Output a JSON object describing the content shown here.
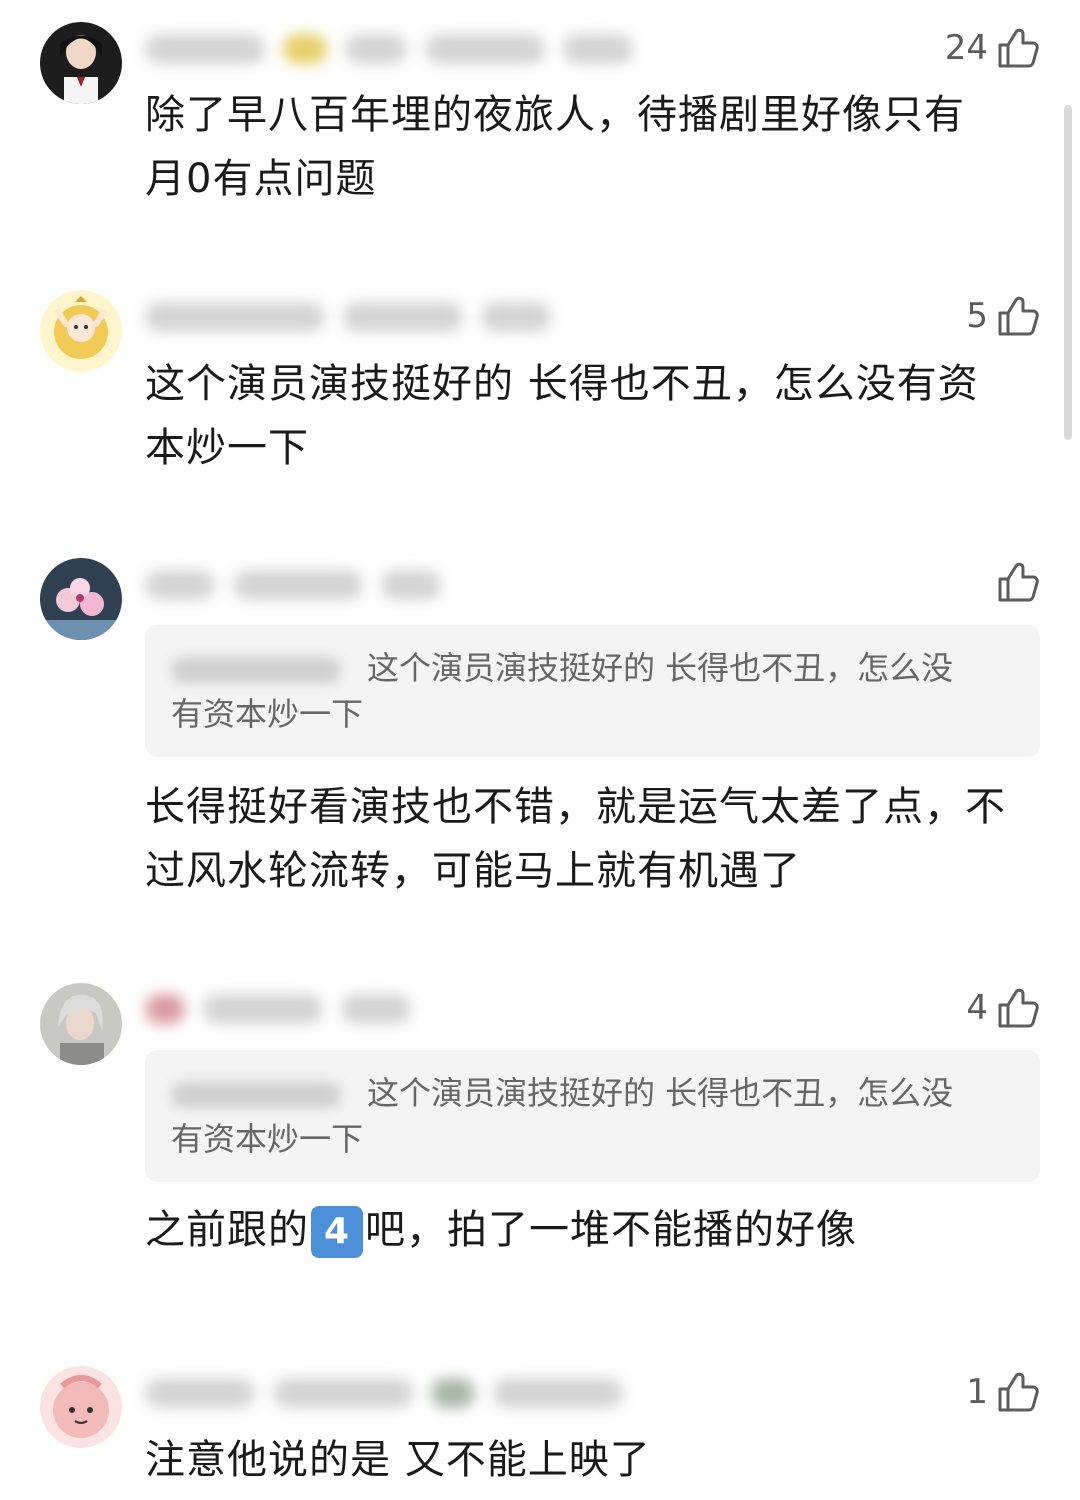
{
  "comments": [
    {
      "likes": "24",
      "text_line1": "除了早八百年埋的夜旅人，待播剧里好像只有",
      "text_line2": "月0有点问题"
    },
    {
      "likes": "5",
      "text_line1": "这个演员演技挺好的 长得也不丑，怎么没有资",
      "text_line2": "本炒一下"
    },
    {
      "likes": "",
      "quote_line1": "这个演员演技挺好的 长得也不丑，怎么没",
      "quote_line2": "有资本炒一下",
      "text_line1": "长得挺好看演技也不错，就是运气太差了点，不",
      "text_line2": "过风水轮流转，可能马上就有机遇了"
    },
    {
      "likes": "4",
      "quote_line1": "这个演员演技挺好的 长得也不丑，怎么没",
      "quote_line2": "有资本炒一下",
      "text_before": "之前跟的",
      "text_emoji": "4",
      "text_after": "吧，拍了一堆不能播的好像"
    },
    {
      "likes": "1",
      "text_line1": "注意他说的是 又不能上映了"
    }
  ],
  "colors": {
    "background": "#ffffff",
    "text": "#1a1a1a",
    "quote_bg": "#f4f4f4",
    "like": "#5c5c5c"
  },
  "icons": {
    "like": "thumbs-up-icon"
  }
}
